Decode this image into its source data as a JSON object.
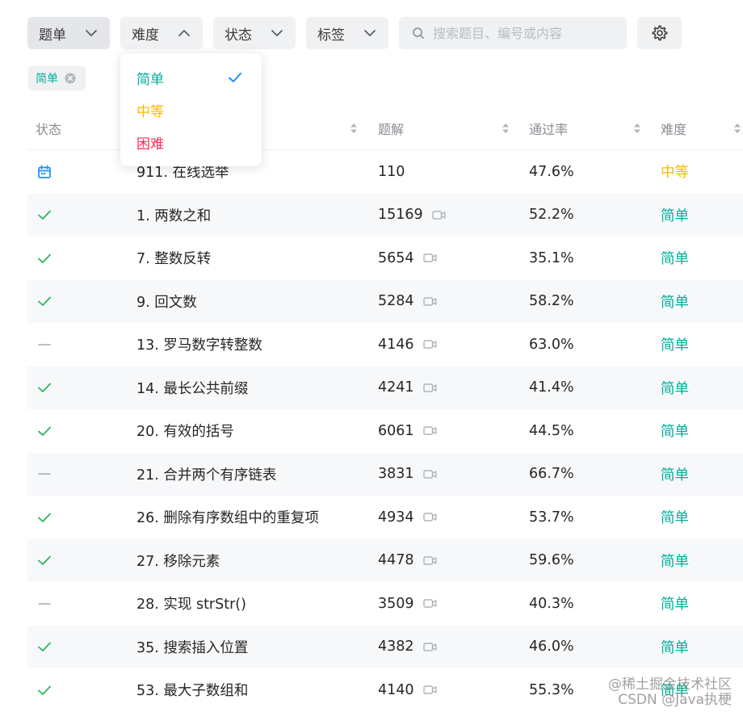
{
  "colors": {
    "easy": "#00af9b",
    "medium": "#ffb800",
    "hard": "#ff2d55",
    "check": "#2db55d",
    "accent": "#1a90ff",
    "dash": "#a5a8ad",
    "alt_row": "#f7f8fa"
  },
  "filters": {
    "problem_list": "题单",
    "difficulty": "难度",
    "status": "状态",
    "tags": "标签"
  },
  "search": {
    "placeholder": "搜索题目、编号或内容"
  },
  "active_chip": {
    "label": "简单"
  },
  "dropdown": {
    "items": [
      {
        "label": "简单",
        "level": "easy",
        "selected": true
      },
      {
        "label": "中等",
        "level": "medium",
        "selected": false
      },
      {
        "label": "困难",
        "level": "hard",
        "selected": false
      }
    ]
  },
  "table": {
    "headers": {
      "status": "状态",
      "solutions": "题解",
      "acceptance": "通过率",
      "difficulty": "难度"
    },
    "rows": [
      {
        "status": "daily",
        "title": "911. 在线选举",
        "solutions": "110",
        "video": false,
        "acceptance": "47.6%",
        "difficulty": "中等",
        "level": "medium"
      },
      {
        "status": "solved",
        "title": "1. 两数之和",
        "solutions": "15169",
        "video": true,
        "acceptance": "52.2%",
        "difficulty": "简单",
        "level": "easy"
      },
      {
        "status": "solved",
        "title": "7. 整数反转",
        "solutions": "5654",
        "video": true,
        "acceptance": "35.1%",
        "difficulty": "简单",
        "level": "easy"
      },
      {
        "status": "solved",
        "title": "9. 回文数",
        "solutions": "5284",
        "video": true,
        "acceptance": "58.2%",
        "difficulty": "简单",
        "level": "easy"
      },
      {
        "status": "none",
        "title": "13. 罗马数字转整数",
        "solutions": "4146",
        "video": true,
        "acceptance": "63.0%",
        "difficulty": "简单",
        "level": "easy"
      },
      {
        "status": "solved",
        "title": "14. 最长公共前缀",
        "solutions": "4241",
        "video": true,
        "acceptance": "41.4%",
        "difficulty": "简单",
        "level": "easy"
      },
      {
        "status": "solved",
        "title": "20. 有效的括号",
        "solutions": "6061",
        "video": true,
        "acceptance": "44.5%",
        "difficulty": "简单",
        "level": "easy"
      },
      {
        "status": "none",
        "title": "21. 合并两个有序链表",
        "solutions": "3831",
        "video": true,
        "acceptance": "66.7%",
        "difficulty": "简单",
        "level": "easy"
      },
      {
        "status": "solved",
        "title": "26. 删除有序数组中的重复项",
        "solutions": "4934",
        "video": true,
        "acceptance": "53.7%",
        "difficulty": "简单",
        "level": "easy"
      },
      {
        "status": "solved",
        "title": "27. 移除元素",
        "solutions": "4478",
        "video": true,
        "acceptance": "59.6%",
        "difficulty": "简单",
        "level": "easy"
      },
      {
        "status": "none",
        "title": "28. 实现 strStr()",
        "solutions": "3509",
        "video": true,
        "acceptance": "40.3%",
        "difficulty": "简单",
        "level": "easy"
      },
      {
        "status": "solved",
        "title": "35. 搜索插入位置",
        "solutions": "4382",
        "video": true,
        "acceptance": "46.0%",
        "difficulty": "简单",
        "level": "easy"
      },
      {
        "status": "solved",
        "title": "53. 最大子数组和",
        "solutions": "4140",
        "video": true,
        "acceptance": "55.3%",
        "difficulty": "简单",
        "level": "easy"
      }
    ]
  },
  "watermark": {
    "line1": "@稀土掘金技术社区",
    "line2": "CSDN @Java执梗"
  }
}
